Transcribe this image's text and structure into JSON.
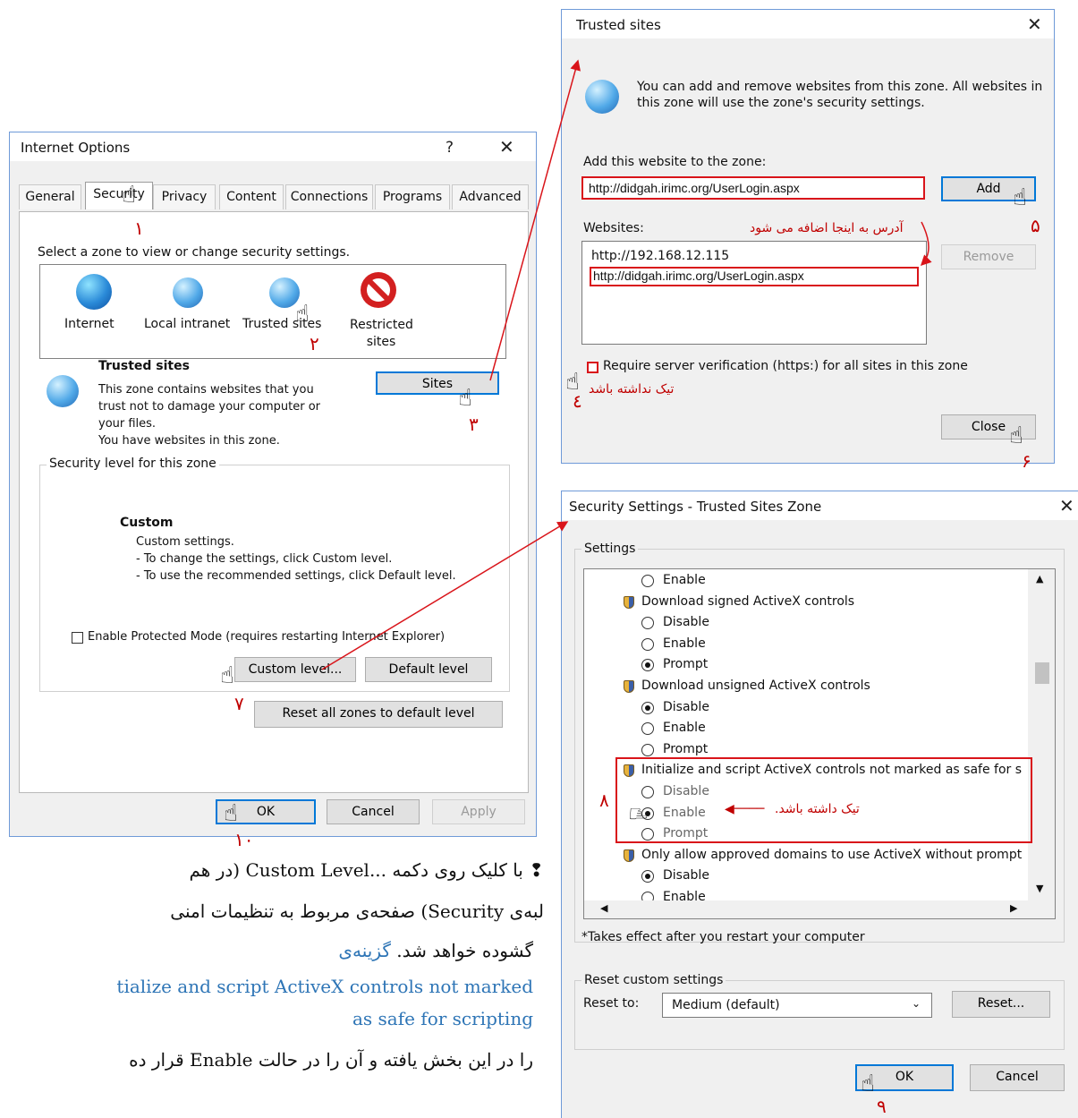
{
  "internet_options": {
    "title": "Internet Options",
    "help_glyph": "?",
    "tabs": [
      "General",
      "Security",
      "Privacy",
      "Content",
      "Connections",
      "Programs",
      "Advanced"
    ],
    "zone_prompt": "Select a zone to view or change security settings.",
    "zones": [
      {
        "label": "Internet",
        "icon": "globe-icon"
      },
      {
        "label": "Local intranet",
        "icon": "intranet-icon"
      },
      {
        "label": "Trusted sites",
        "icon": "trusted-sites-icon"
      },
      {
        "label": "Restricted sites",
        "icon": "restricted-icon"
      }
    ],
    "zone_heading": "Trusted sites",
    "zone_desc_1": "This zone contains websites that you",
    "zone_desc_2": "trust not to damage your computer or",
    "zone_desc_3": "your files.",
    "zone_desc_4": "You have websites in this zone.",
    "sites_button": "Sites",
    "security_level_legend": "Security level for this zone",
    "level_name": "Custom",
    "level_line_1": "Custom settings.",
    "level_line_2": "- To change the settings, click Custom level.",
    "level_line_3": "- To use the recommended settings, click Default level.",
    "protected_mode": "Enable Protected Mode (requires restarting Internet Explorer)",
    "custom_level_button": "Custom level...",
    "default_level_button": "Default level",
    "reset_all_button": "Reset all zones to default level",
    "ok_button": "OK",
    "cancel_button": "Cancel",
    "apply_button": "Apply"
  },
  "trusted_sites": {
    "title": "Trusted sites",
    "info_1": "You can add and remove websites from this zone. All websites in",
    "info_2": "this zone will use the zone's security settings.",
    "add_label": "Add this website to the zone:",
    "add_value": "http://didgah.irimc.org/UserLogin.aspx",
    "add_button": "Add",
    "websites_label": "Websites:",
    "websites": [
      "http://192.168.12.115",
      "http://didgah.irimc.org/UserLogin.aspx"
    ],
    "remove_button": "Remove",
    "require_verification": "Require server verification (https:) for all sites in this zone",
    "close_button": "Close",
    "note_added": "آدرس به اینجا اضافه می شود",
    "note_uncheck": "تیک نداشته باشد"
  },
  "security_settings": {
    "title": "Security Settings - Trusted Sites Zone",
    "settings_legend": "Settings",
    "items": [
      {
        "kind": "radio",
        "label": "Enable",
        "checked": false
      },
      {
        "kind": "head",
        "label": "Download signed ActiveX controls"
      },
      {
        "kind": "radio",
        "label": "Disable",
        "checked": false
      },
      {
        "kind": "radio",
        "label": "Enable",
        "checked": false
      },
      {
        "kind": "radio",
        "label": "Prompt",
        "checked": true
      },
      {
        "kind": "head",
        "label": "Download unsigned ActiveX controls"
      },
      {
        "kind": "radio",
        "label": "Disable",
        "checked": true
      },
      {
        "kind": "radio",
        "label": "Enable",
        "checked": false
      },
      {
        "kind": "radio",
        "label": "Prompt",
        "checked": false
      },
      {
        "kind": "head",
        "label": "Initialize and script ActiveX controls not marked as safe for s"
      },
      {
        "kind": "radio",
        "label": "Disable",
        "checked": false,
        "dim": true
      },
      {
        "kind": "radio",
        "label": "Enable",
        "checked": true,
        "dim": true
      },
      {
        "kind": "radio",
        "label": "Prompt",
        "checked": false,
        "dim": true
      },
      {
        "kind": "head",
        "label": "Only allow approved domains to use ActiveX without prompt"
      },
      {
        "kind": "radio",
        "label": "Disable",
        "checked": true
      },
      {
        "kind": "radio",
        "label": "Enable",
        "checked": false
      }
    ],
    "note_enable": "تیک داشته باشد.",
    "restart_note": "*Takes effect after you restart your computer",
    "reset_legend": "Reset custom settings",
    "reset_to_label": "Reset to:",
    "reset_to_value": "Medium (default)",
    "reset_button": "Reset...",
    "ok_button": "OK",
    "cancel_button": "Cancel"
  },
  "step_numbers": [
    "۱",
    "۲",
    "۳",
    "٤",
    "۵",
    "۶",
    "۷",
    "۸",
    "۹",
    "۱۰"
  ],
  "paragraph": {
    "line_1": "با کلیک روی دکمه ...Custom Level (در هم",
    "line_2": "لبه‌ی Security) صفحه‌ی مربوط به تنظیمات امنی",
    "line_3a": "گشوده خواهد شد.",
    "line_3b": "گزینه‌ی",
    "line_4": "tialize and script ActiveX controls not marked",
    "line_5": "as safe for scripting",
    "line_6": "را در این بخش یافته و آن را در حالت Enable قرار ده"
  }
}
